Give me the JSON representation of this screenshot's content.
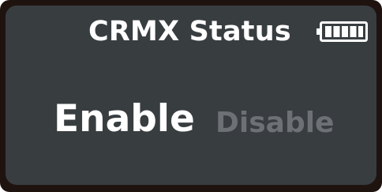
{
  "header": {
    "title": "CRMX Status",
    "battery_icon": "battery-full-icon"
  },
  "options": [
    {
      "label": "Enable",
      "selected": true
    },
    {
      "label": "Disable",
      "selected": false
    }
  ],
  "colors": {
    "bezel": "#1f1310",
    "screen": "#383d40",
    "selected_text": "#ffffff",
    "unselected_text": "#6d7175"
  }
}
